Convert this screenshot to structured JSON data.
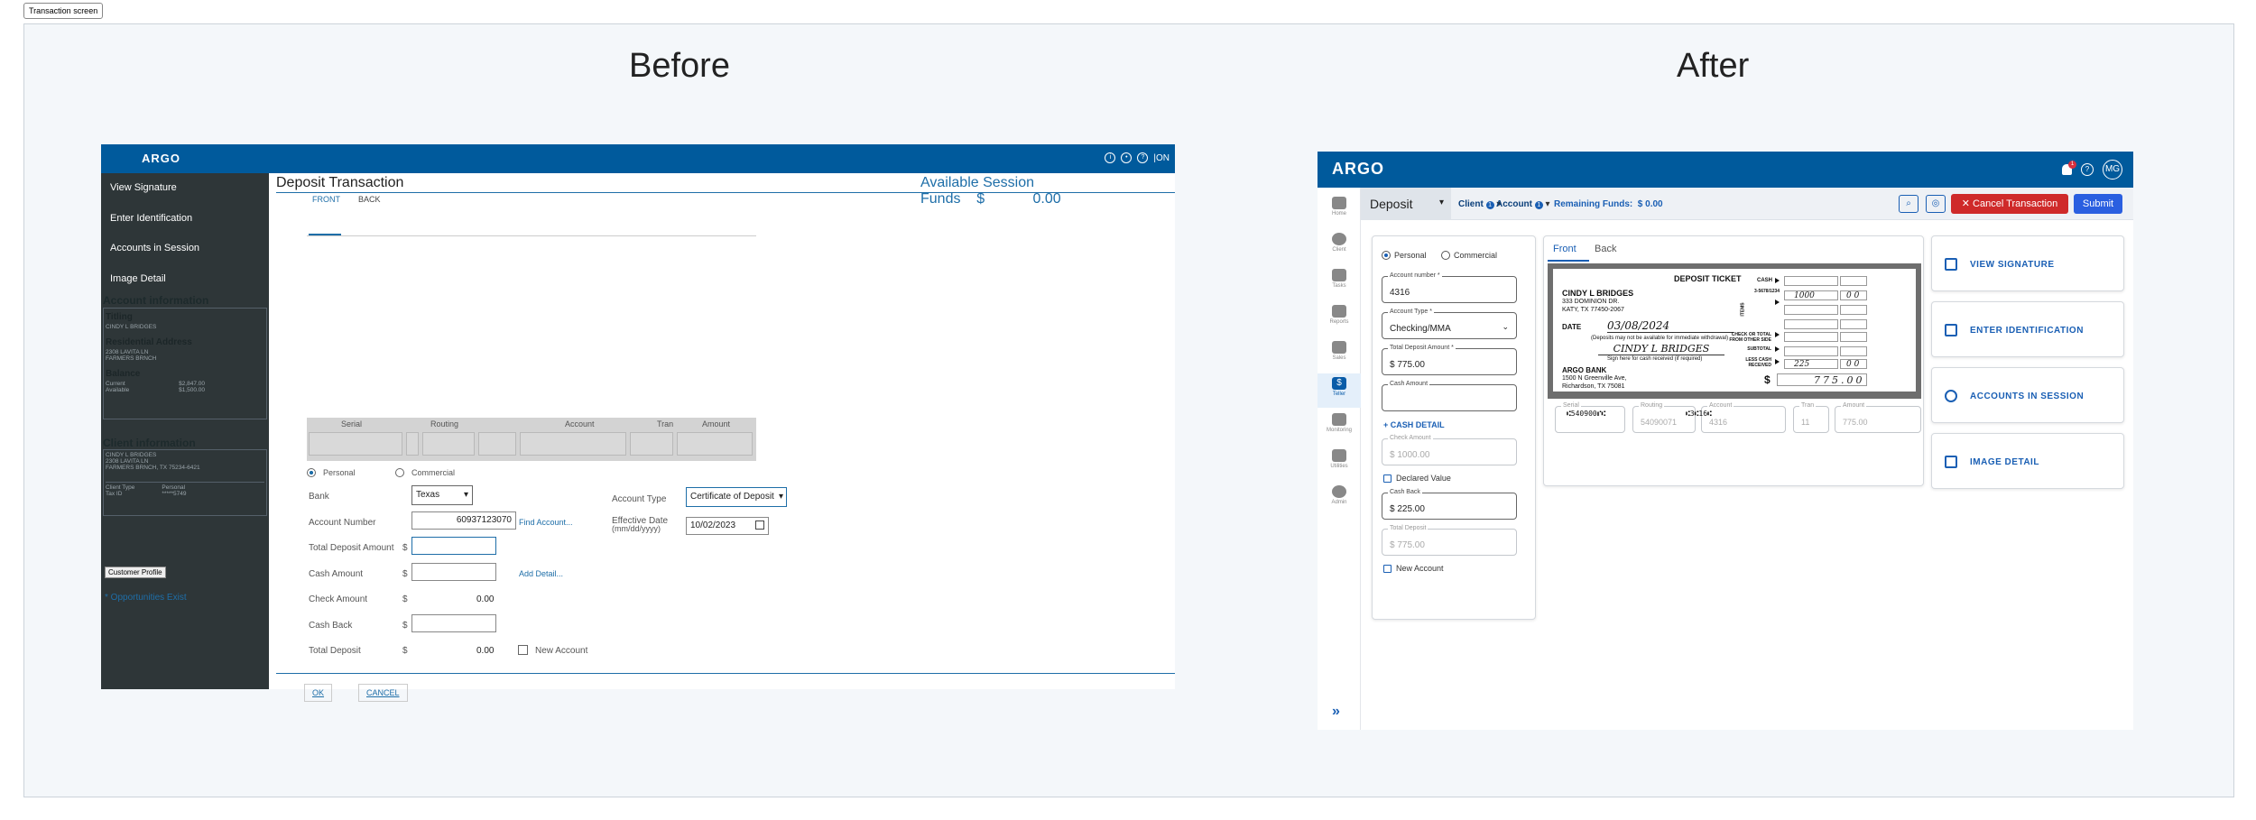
{
  "screen_tag": "Transaction screen",
  "before": {
    "heading": "Before",
    "topbar": {
      "logo": "ARGO",
      "on": "ON"
    },
    "nav": [
      "View Signature",
      "Enter Identification",
      "Accounts in Session",
      "Image Detail"
    ],
    "account_info": {
      "title": "Account information",
      "titling_label": "Titling",
      "titling_value": "CINDY L BRIDGES",
      "res_label": "Residential Address",
      "res_line1": "2308 LAVITA LN",
      "res_line2": "FARMERS BRNCH",
      "balance_label": "Balance",
      "current_label": "Current",
      "current_value": "$2,847.00",
      "available_label": "Available",
      "available_value": "$1,500.00"
    },
    "client_info": {
      "title": "Client information",
      "line1": "CINDY L BRIDGES",
      "line2": "2308 LAVITA LN",
      "line3": "FARMERS BRNCH, TX 75234-6421",
      "type_label": "Client Type",
      "type_value": "Personal",
      "tax_label": "Tax ID",
      "tax_value": "*****5749"
    },
    "customer_profile": "Customer Profile",
    "opportunities": "* Opportunities Exist",
    "title": "Deposit Transaction",
    "session_funds_label": "Available Session Funds",
    "session_funds_currency": "$",
    "session_funds_value": "0.00",
    "tabs": [
      "FRONT",
      "BACK"
    ],
    "micr_headers": [
      "Serial",
      "Routing",
      "Account",
      "Tran",
      "Amount"
    ],
    "radio_personal": "Personal",
    "radio_commercial": "Commercial",
    "bank_label": "Bank",
    "bank_value": "Texas",
    "account_number_label": "Account Number",
    "account_number_value": "60937123070",
    "find_account": "Find Account...",
    "total_deposit_label": "Total Deposit Amount",
    "cash_amount_label": "Cash Amount",
    "add_detail": "Add Detail...",
    "check_amount_label": "Check Amount",
    "check_amount_value": "0.00",
    "cash_back_label": "Cash Back",
    "total_deposit2_label": "Total Deposit",
    "total_deposit2_value": "0.00",
    "new_account": "New Account",
    "account_type_label": "Account Type",
    "account_type_value": "Certificate of Deposit",
    "effective_date_label": "Effective Date",
    "effective_date_format": "(mm/dd/yyyy)",
    "effective_date_value": "10/02/2023",
    "currency": "$",
    "ok": "OK",
    "cancel": "CANCEL"
  },
  "after": {
    "heading": "After",
    "topbar": {
      "logo": "ARGO",
      "badge": "1",
      "avatar": "MG"
    },
    "sidebar": [
      "Home",
      "Client",
      "Tasks",
      "Reports",
      "Sales",
      "Teller",
      "Monitoring",
      "Utilities",
      "Admin"
    ],
    "header": {
      "transaction": "Deposit",
      "client": "Client",
      "client_count": "1",
      "account": "Account",
      "account_count": "1",
      "remaining_label": "Remaining Funds:",
      "remaining_value": "$ 0.00",
      "cancel": "Cancel Transaction",
      "submit": "Submit"
    },
    "form": {
      "personal": "Personal",
      "commercial": "Commercial",
      "account_number_label": "Account number *",
      "account_number_value": "4316",
      "account_type_label": "Account Type *",
      "account_type_value": "Checking/MMA",
      "total_deposit_label": "Total Deposit Amount *",
      "total_deposit_value": "$ 775.00",
      "cash_amount_label": "Cash Amount",
      "cash_detail": "CASH DETAIL",
      "check_amount_label": "Check Amount",
      "check_amount_value": "$ 1000.00",
      "declared_value": "Declared Value",
      "cash_back_label": "Cash Back",
      "cash_back_value": "$ 225.00",
      "total_deposit2_label": "Total Deposit",
      "total_deposit2_value": "$ 775.00",
      "new_account": "New Account"
    },
    "check_tabs": [
      "Front",
      "Back"
    ],
    "ticket": {
      "title": "DEPOSIT TICKET",
      "name": "CINDY L BRIDGES",
      "addr1": "333 DOMINION DR.",
      "addr2": "KATY, TX 77450-2067",
      "date_label": "DATE",
      "date_value": "03/08/2024",
      "note1": "(Deposits may not be available for immediate withdrawal)",
      "signature": "CINDY L BRIDGES",
      "note2": "Sign here for cash received (if required)",
      "bank": "ARGO BANK",
      "bank_addr1": "1500 N Greenville Ave,",
      "bank_addr2": "Richardson, TX 75081",
      "micr1": "⑆540900⑈⑆",
      "micr2": "⑆3⑆16⑆",
      "cash_label": "CASH",
      "routing_side": "3-5678/1234",
      "check_label": "CHECK OR TOTAL FROM OTHER SIDE",
      "subtotal_label": "SUBTOTAL",
      "less_cash_label": "LESS CASH RECEIVED",
      "checks_value": "1000",
      "checks_cents": "0 0",
      "less_cash_value": "225",
      "less_cash_cents": "0 0",
      "total_digits": "775.00",
      "dollar": "$",
      "items_label": "ITEMS"
    },
    "micr": [
      {
        "label": "Serial",
        "value": ""
      },
      {
        "label": "Routing",
        "value": "54090071"
      },
      {
        "label": "Account",
        "value": "4316"
      },
      {
        "label": "Tran",
        "value": "11"
      },
      {
        "label": "Amount",
        "value": "775.00"
      }
    ],
    "actions": [
      "VIEW SIGNATURE",
      "ENTER IDENTIFICATION",
      "ACCOUNTS IN SESSION",
      "IMAGE DETAIL"
    ]
  }
}
